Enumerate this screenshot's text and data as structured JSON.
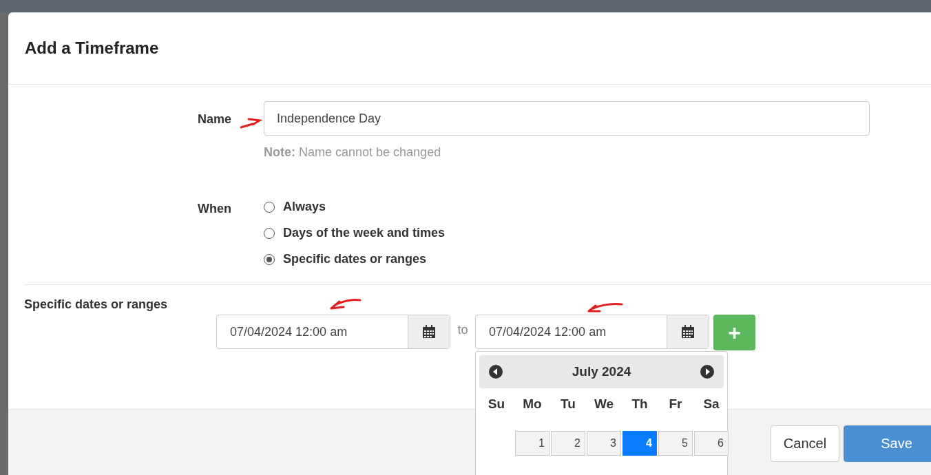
{
  "dialog": {
    "title": "Add a Timeframe"
  },
  "name_field": {
    "label": "Name",
    "value": "Independence Day",
    "note": "**Note:** Name cannot be changed"
  },
  "when": {
    "label": "When",
    "options": [
      {
        "label": "Always",
        "selected": false
      },
      {
        "label": "Days of the week and times",
        "selected": false
      },
      {
        "label": "Specific dates or ranges",
        "selected": true
      }
    ]
  },
  "specific": {
    "label": "Specific dates or ranges",
    "start": "07/04/2024 12:00 am",
    "separator": "to",
    "end": "07/04/2024 12:00 am",
    "add_button": "+"
  },
  "calendar": {
    "month": "July 2024",
    "weekdays": [
      "Su",
      "Mo",
      "Tu",
      "We",
      "Th",
      "Fr",
      "Sa"
    ],
    "days": [
      {
        "kind": "empty"
      },
      {
        "kind": "day",
        "label": "1",
        "selected": false
      },
      {
        "kind": "day",
        "label": "2",
        "selected": false
      },
      {
        "kind": "day",
        "label": "3",
        "selected": false
      },
      {
        "kind": "day",
        "label": "4",
        "selected": true
      },
      {
        "kind": "day",
        "label": "5",
        "selected": false
      },
      {
        "kind": "day",
        "label": "6",
        "selected": false
      }
    ]
  },
  "footer": {
    "buttons": [
      {
        "label": "Cancel",
        "kind": "secondary"
      },
      {
        "label": "Save",
        "kind": "primary"
      }
    ]
  }
}
